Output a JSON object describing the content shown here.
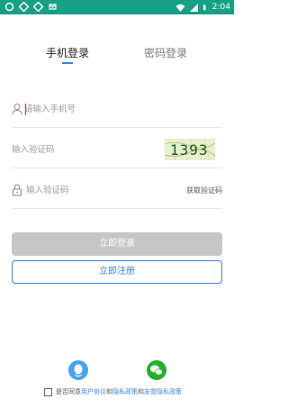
{
  "status_bar": {
    "time": "2:04",
    "left_icons": [
      "notification-icon",
      "notification-icon",
      "notification-icon",
      "notification-icon"
    ],
    "right_icons": [
      "wifi-icon",
      "signal-icon",
      "battery-icon"
    ],
    "bg_color": "#16a085"
  },
  "tabs": [
    {
      "label": "手机登录",
      "active": true
    },
    {
      "label": "密码登录",
      "active": false
    }
  ],
  "phone_field": {
    "placeholder": "请输入手机号",
    "icon": "user-icon"
  },
  "captcha_field": {
    "placeholder": "输入验证码",
    "captcha_text": "1393"
  },
  "code_field": {
    "placeholder": "输入验证码",
    "icon": "lock-icon",
    "get_code_label": "获取验证码"
  },
  "buttons": {
    "login_label": "立即登录",
    "register_label": "立即注册"
  },
  "social": [
    {
      "name": "qq",
      "icon": "qq-icon",
      "color": "#45a4f0"
    },
    {
      "name": "wechat",
      "icon": "wechat-icon",
      "color": "#21b12c"
    }
  ],
  "agreement": {
    "prefix": "是否同意",
    "user_agreement": "用户协议",
    "and1": "和",
    "privacy_policy": "隐私政策",
    "and2": "和",
    "friend_privacy": "友盟隐私政策",
    "checked": false
  },
  "colors": {
    "accent": "#3b82e6",
    "disabled_button": "#c6c6c6"
  }
}
